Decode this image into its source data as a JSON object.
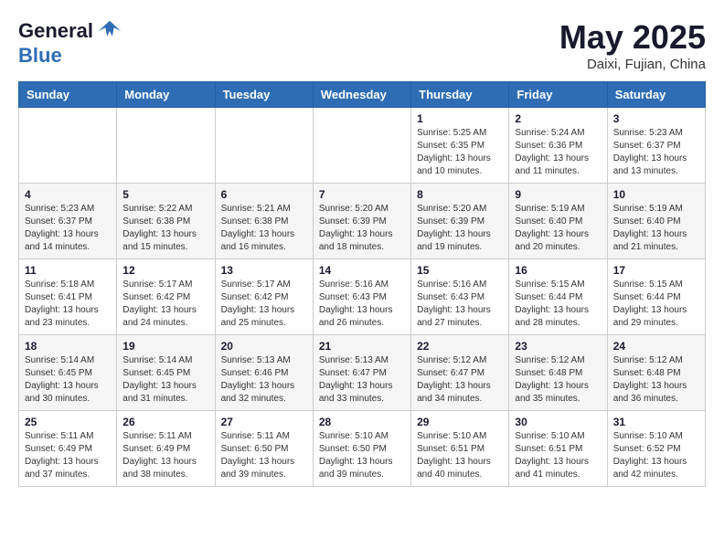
{
  "logo": {
    "general": "General",
    "blue": "Blue"
  },
  "title": "May 2025",
  "subtitle": "Daixi, Fujian, China",
  "days_of_week": [
    "Sunday",
    "Monday",
    "Tuesday",
    "Wednesday",
    "Thursday",
    "Friday",
    "Saturday"
  ],
  "weeks": [
    [
      {
        "day": "",
        "info": ""
      },
      {
        "day": "",
        "info": ""
      },
      {
        "day": "",
        "info": ""
      },
      {
        "day": "",
        "info": ""
      },
      {
        "day": "1",
        "info": "Sunrise: 5:25 AM\nSunset: 6:35 PM\nDaylight: 13 hours and 10 minutes."
      },
      {
        "day": "2",
        "info": "Sunrise: 5:24 AM\nSunset: 6:36 PM\nDaylight: 13 hours and 11 minutes."
      },
      {
        "day": "3",
        "info": "Sunrise: 5:23 AM\nSunset: 6:37 PM\nDaylight: 13 hours and 13 minutes."
      }
    ],
    [
      {
        "day": "4",
        "info": "Sunrise: 5:23 AM\nSunset: 6:37 PM\nDaylight: 13 hours and 14 minutes."
      },
      {
        "day": "5",
        "info": "Sunrise: 5:22 AM\nSunset: 6:38 PM\nDaylight: 13 hours and 15 minutes."
      },
      {
        "day": "6",
        "info": "Sunrise: 5:21 AM\nSunset: 6:38 PM\nDaylight: 13 hours and 16 minutes."
      },
      {
        "day": "7",
        "info": "Sunrise: 5:20 AM\nSunset: 6:39 PM\nDaylight: 13 hours and 18 minutes."
      },
      {
        "day": "8",
        "info": "Sunrise: 5:20 AM\nSunset: 6:39 PM\nDaylight: 13 hours and 19 minutes."
      },
      {
        "day": "9",
        "info": "Sunrise: 5:19 AM\nSunset: 6:40 PM\nDaylight: 13 hours and 20 minutes."
      },
      {
        "day": "10",
        "info": "Sunrise: 5:19 AM\nSunset: 6:40 PM\nDaylight: 13 hours and 21 minutes."
      }
    ],
    [
      {
        "day": "11",
        "info": "Sunrise: 5:18 AM\nSunset: 6:41 PM\nDaylight: 13 hours and 23 minutes."
      },
      {
        "day": "12",
        "info": "Sunrise: 5:17 AM\nSunset: 6:42 PM\nDaylight: 13 hours and 24 minutes."
      },
      {
        "day": "13",
        "info": "Sunrise: 5:17 AM\nSunset: 6:42 PM\nDaylight: 13 hours and 25 minutes."
      },
      {
        "day": "14",
        "info": "Sunrise: 5:16 AM\nSunset: 6:43 PM\nDaylight: 13 hours and 26 minutes."
      },
      {
        "day": "15",
        "info": "Sunrise: 5:16 AM\nSunset: 6:43 PM\nDaylight: 13 hours and 27 minutes."
      },
      {
        "day": "16",
        "info": "Sunrise: 5:15 AM\nSunset: 6:44 PM\nDaylight: 13 hours and 28 minutes."
      },
      {
        "day": "17",
        "info": "Sunrise: 5:15 AM\nSunset: 6:44 PM\nDaylight: 13 hours and 29 minutes."
      }
    ],
    [
      {
        "day": "18",
        "info": "Sunrise: 5:14 AM\nSunset: 6:45 PM\nDaylight: 13 hours and 30 minutes."
      },
      {
        "day": "19",
        "info": "Sunrise: 5:14 AM\nSunset: 6:45 PM\nDaylight: 13 hours and 31 minutes."
      },
      {
        "day": "20",
        "info": "Sunrise: 5:13 AM\nSunset: 6:46 PM\nDaylight: 13 hours and 32 minutes."
      },
      {
        "day": "21",
        "info": "Sunrise: 5:13 AM\nSunset: 6:47 PM\nDaylight: 13 hours and 33 minutes."
      },
      {
        "day": "22",
        "info": "Sunrise: 5:12 AM\nSunset: 6:47 PM\nDaylight: 13 hours and 34 minutes."
      },
      {
        "day": "23",
        "info": "Sunrise: 5:12 AM\nSunset: 6:48 PM\nDaylight: 13 hours and 35 minutes."
      },
      {
        "day": "24",
        "info": "Sunrise: 5:12 AM\nSunset: 6:48 PM\nDaylight: 13 hours and 36 minutes."
      }
    ],
    [
      {
        "day": "25",
        "info": "Sunrise: 5:11 AM\nSunset: 6:49 PM\nDaylight: 13 hours and 37 minutes."
      },
      {
        "day": "26",
        "info": "Sunrise: 5:11 AM\nSunset: 6:49 PM\nDaylight: 13 hours and 38 minutes."
      },
      {
        "day": "27",
        "info": "Sunrise: 5:11 AM\nSunset: 6:50 PM\nDaylight: 13 hours and 39 minutes."
      },
      {
        "day": "28",
        "info": "Sunrise: 5:10 AM\nSunset: 6:50 PM\nDaylight: 13 hours and 39 minutes."
      },
      {
        "day": "29",
        "info": "Sunrise: 5:10 AM\nSunset: 6:51 PM\nDaylight: 13 hours and 40 minutes."
      },
      {
        "day": "30",
        "info": "Sunrise: 5:10 AM\nSunset: 6:51 PM\nDaylight: 13 hours and 41 minutes."
      },
      {
        "day": "31",
        "info": "Sunrise: 5:10 AM\nSunset: 6:52 PM\nDaylight: 13 hours and 42 minutes."
      }
    ]
  ]
}
